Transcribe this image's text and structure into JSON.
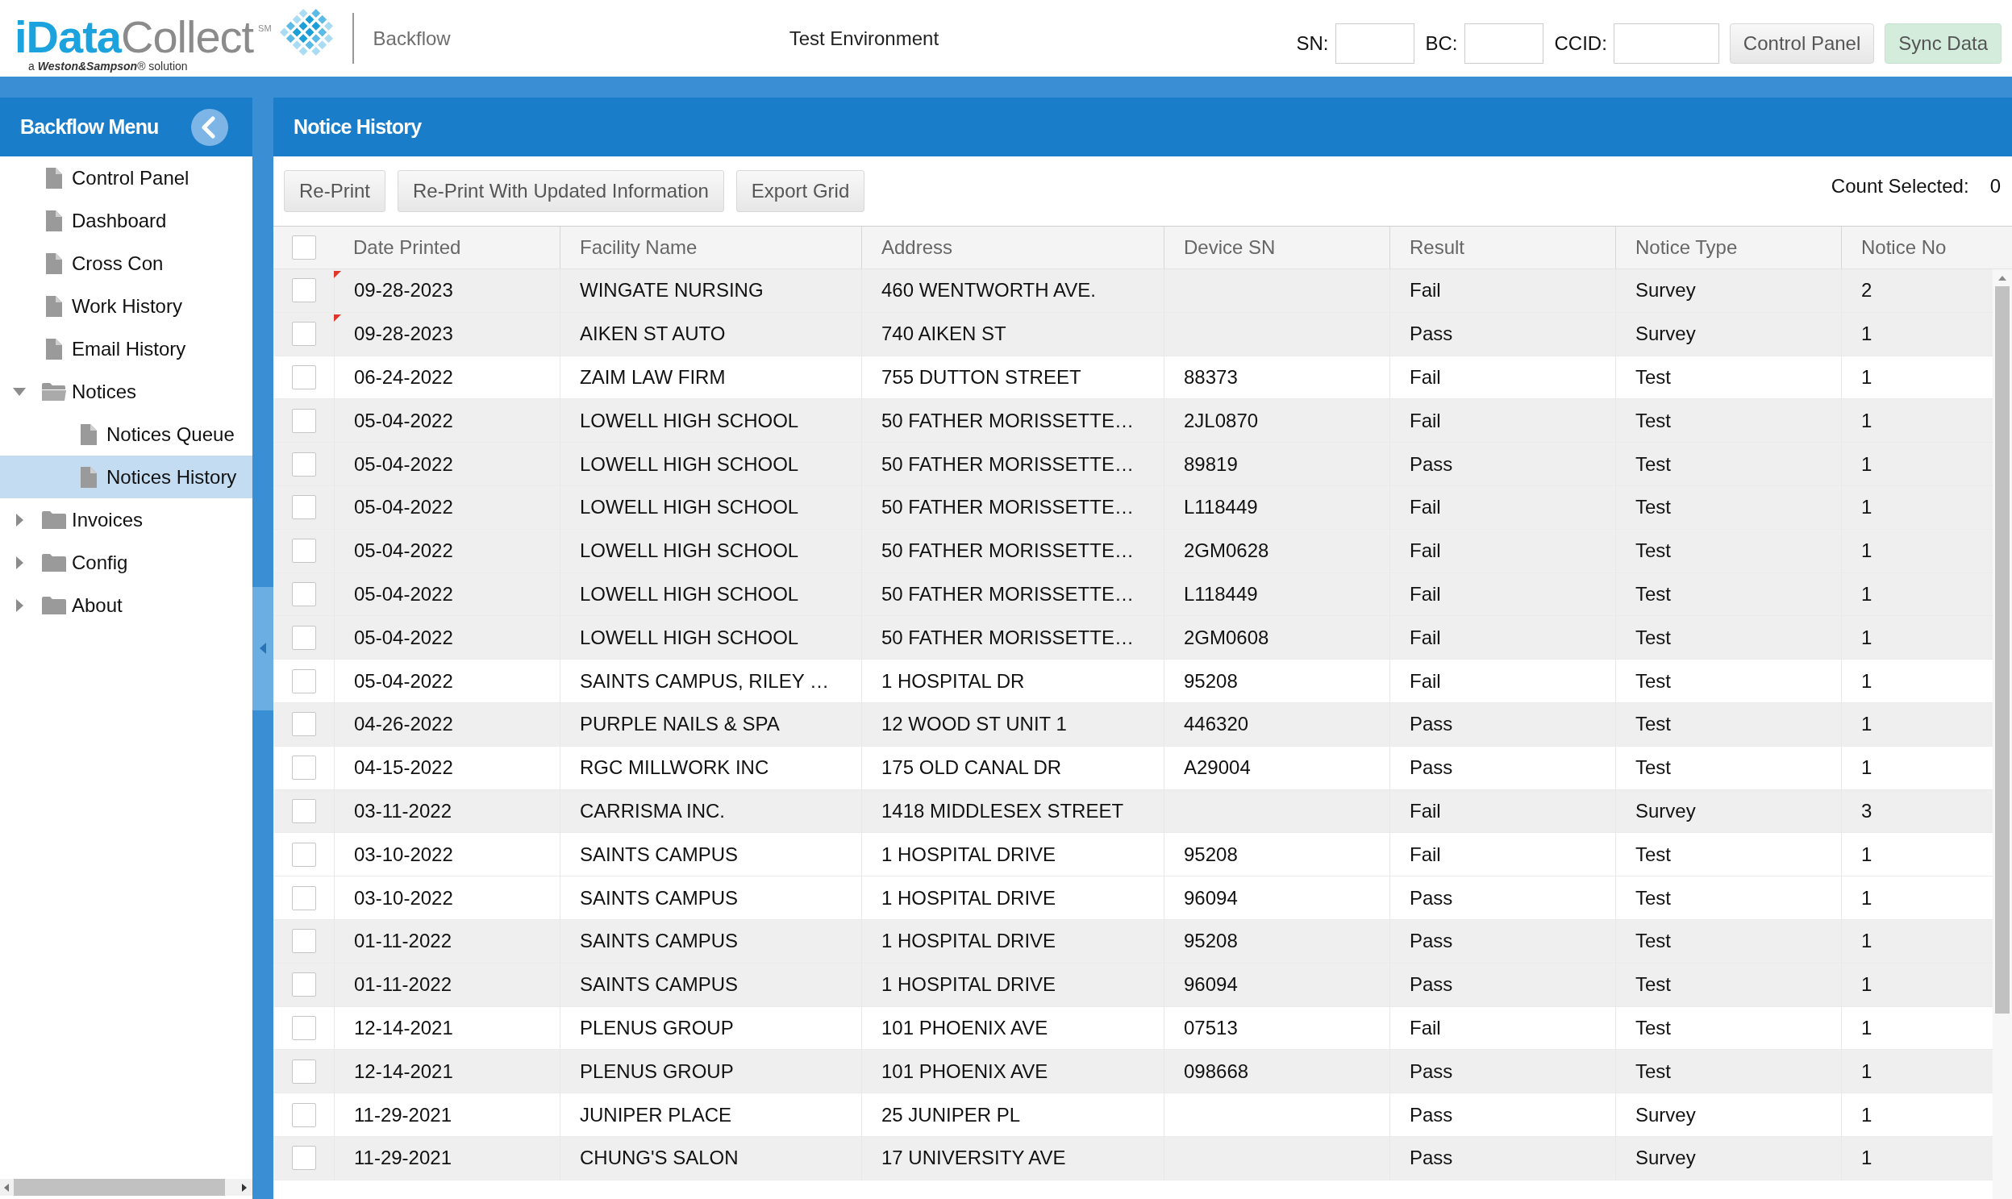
{
  "header": {
    "logo": {
      "wordmark": "**iData**Collect$^{SM}$",
      "tagline": "a **Weston&Sampson**® solution"
    },
    "module": "Backflow",
    "environment": "Test Environment",
    "fields": [
      {
        "label": "SN:"
      },
      {
        "label": "BC:"
      },
      {
        "label": "CCID:"
      }
    ],
    "buttons": [
      {
        "label": "Control Panel",
        "kind": "default"
      },
      {
        "label": "Sync Data",
        "kind": "success"
      }
    ]
  },
  "sidebar": {
    "title": "Backflow Menu",
    "items": [
      {
        "label": "Control Panel",
        "kind": "page",
        "selected": false
      },
      {
        "label": "Dashboard",
        "kind": "page",
        "selected": false
      },
      {
        "label": "Cross Con",
        "kind": "page",
        "selected": false
      },
      {
        "label": "Work History",
        "kind": "page",
        "selected": false
      },
      {
        "label": "Email History",
        "kind": "page",
        "selected": false
      },
      {
        "label": "Notices",
        "kind": "folder",
        "expanded": true,
        "selected": false,
        "children": [
          {
            "label": "Notices Queue",
            "kind": "page",
            "selected": false
          },
          {
            "label": "Notices History",
            "kind": "page",
            "selected": true
          }
        ]
      },
      {
        "label": "Invoices",
        "kind": "folder",
        "expanded": false,
        "selected": false
      },
      {
        "label": "Config",
        "kind": "folder",
        "expanded": false,
        "selected": false
      },
      {
        "label": "About",
        "kind": "folder",
        "expanded": false,
        "selected": false
      }
    ]
  },
  "panel": {
    "title": "Notice History",
    "toolbar": {
      "buttons": [
        "Re-Print",
        "Re-Print With Updated Information",
        "Export Grid"
      ],
      "count_label": "Count Selected:",
      "count": "0"
    },
    "grid": {
      "select_all": {
        "checked": false
      },
      "columns": [
        "Date Printed",
        "Facility Name",
        "Address",
        "Device SN",
        "Result",
        "Notice Type",
        "Notice No"
      ],
      "rows": [
        {
          "checked": false,
          "flagged": true,
          "highlighted": true,
          "date_printed": "09-28-2023",
          "facility_name": "WINGATE NURSING",
          "address": "460 WENTWORTH AVE.",
          "result": "Fail",
          "notice_type": "Survey",
          "notice_no": "2"
        },
        {
          "checked": false,
          "flagged": true,
          "highlighted": true,
          "date_printed": "09-28-2023",
          "facility_name": "AIKEN ST AUTO",
          "address": "740 AIKEN ST",
          "result": "Pass",
          "notice_type": "Survey",
          "notice_no": "1"
        },
        {
          "checked": false,
          "flagged": false,
          "highlighted": false,
          "date_printed": "06-24-2022",
          "facility_name": "ZAIM LAW FIRM",
          "address": "755 DUTTON STREET",
          "device_sn": "88373",
          "result": "Fail",
          "notice_type": "Test",
          "notice_no": "1"
        },
        {
          "checked": false,
          "flagged": false,
          "highlighted": true,
          "date_printed": "05-04-2022",
          "facility_name": "LOWELL HIGH SCHOOL",
          "address": "50 FATHER MORISSETTE…",
          "device_sn": "2JL0870",
          "result": "Fail",
          "notice_type": "Test",
          "notice_no": "1"
        },
        {
          "checked": false,
          "flagged": false,
          "highlighted": true,
          "date_printed": "05-04-2022",
          "facility_name": "LOWELL HIGH SCHOOL",
          "address": "50 FATHER MORISSETTE…",
          "device_sn": "89819",
          "result": "Pass",
          "notice_type": "Test",
          "notice_no": "1"
        },
        {
          "checked": false,
          "flagged": false,
          "highlighted": true,
          "date_printed": "05-04-2022",
          "facility_name": "LOWELL HIGH SCHOOL",
          "address": "50 FATHER MORISSETTE…",
          "device_sn": "L118449",
          "result": "Fail",
          "notice_type": "Test",
          "notice_no": "1"
        },
        {
          "checked": false,
          "flagged": false,
          "highlighted": true,
          "date_printed": "05-04-2022",
          "facility_name": "LOWELL HIGH SCHOOL",
          "address": "50 FATHER MORISSETTE…",
          "device_sn": "2GM0628",
          "result": "Fail",
          "notice_type": "Test",
          "notice_no": "1"
        },
        {
          "checked": false,
          "flagged": false,
          "highlighted": true,
          "date_printed": "05-04-2022",
          "facility_name": "LOWELL HIGH SCHOOL",
          "address": "50 FATHER MORISSETTE…",
          "device_sn": "L118449",
          "result": "Fail",
          "notice_type": "Test",
          "notice_no": "1"
        },
        {
          "checked": false,
          "flagged": false,
          "highlighted": true,
          "date_printed": "05-04-2022",
          "facility_name": "LOWELL HIGH SCHOOL",
          "address": "50 FATHER MORISSETTE…",
          "device_sn": "2GM0608",
          "result": "Fail",
          "notice_type": "Test",
          "notice_no": "1"
        },
        {
          "checked": false,
          "flagged": false,
          "highlighted": false,
          "date_printed": "05-04-2022",
          "facility_name": "SAINTS CAMPUS, RILEY …",
          "address": "1 HOSPITAL DR",
          "device_sn": "95208",
          "result": "Fail",
          "notice_type": "Test",
          "notice_no": "1"
        },
        {
          "checked": false,
          "flagged": false,
          "highlighted": true,
          "date_printed": "04-26-2022",
          "facility_name": "PURPLE NAILS & SPA",
          "address": "12 WOOD ST UNIT 1",
          "device_sn": "446320",
          "result": "Pass",
          "notice_type": "Test",
          "notice_no": "1"
        },
        {
          "checked": false,
          "flagged": false,
          "highlighted": false,
          "date_printed": "04-15-2022",
          "facility_name": "RGC MILLWORK INC",
          "address": "175 OLD CANAL DR",
          "device_sn": "A29004",
          "result": "Pass",
          "notice_type": "Test",
          "notice_no": "1"
        },
        {
          "checked": false,
          "flagged": false,
          "highlighted": true,
          "date_printed": "03-11-2022",
          "facility_name": "CARRISMA INC.",
          "address": "1418 MIDDLESEX STREET",
          "result": "Fail",
          "notice_type": "Survey",
          "notice_no": "3"
        },
        {
          "checked": false,
          "flagged": false,
          "highlighted": false,
          "date_printed": "03-10-2022",
          "facility_name": "SAINTS CAMPUS",
          "address": "1 HOSPITAL DRIVE",
          "device_sn": "95208",
          "result": "Fail",
          "notice_type": "Test",
          "notice_no": "1"
        },
        {
          "checked": false,
          "flagged": false,
          "highlighted": false,
          "date_printed": "03-10-2022",
          "facility_name": "SAINTS CAMPUS",
          "address": "1 HOSPITAL DRIVE",
          "device_sn": "96094",
          "result": "Pass",
          "notice_type": "Test",
          "notice_no": "1"
        },
        {
          "checked": false,
          "flagged": false,
          "highlighted": true,
          "date_printed": "01-11-2022",
          "facility_name": "SAINTS CAMPUS",
          "address": "1 HOSPITAL DRIVE",
          "device_sn": "95208",
          "result": "Pass",
          "notice_type": "Test",
          "notice_no": "1"
        },
        {
          "checked": false,
          "flagged": false,
          "highlighted": true,
          "date_printed": "01-11-2022",
          "facility_name": "SAINTS CAMPUS",
          "address": "1 HOSPITAL DRIVE",
          "device_sn": "96094",
          "result": "Pass",
          "notice_type": "Test",
          "notice_no": "1"
        },
        {
          "checked": false,
          "flagged": false,
          "highlighted": false,
          "date_printed": "12-14-2021",
          "facility_name": "PLENUS GROUP",
          "address": "101 PHOENIX AVE",
          "device_sn": "07513",
          "result": "Fail",
          "notice_type": "Test",
          "notice_no": "1"
        },
        {
          "checked": false,
          "flagged": false,
          "highlighted": true,
          "date_printed": "12-14-2021",
          "facility_name": "PLENUS GROUP",
          "address": "101 PHOENIX AVE",
          "device_sn": "098668",
          "result": "Pass",
          "notice_type": "Test",
          "notice_no": "1"
        },
        {
          "checked": false,
          "flagged": false,
          "highlighted": false,
          "date_printed": "11-29-2021",
          "facility_name": "JUNIPER PLACE",
          "address": "25 JUNIPER PL",
          "result": "Pass",
          "notice_type": "Survey",
          "notice_no": "1"
        },
        {
          "checked": false,
          "flagged": false,
          "highlighted": true,
          "date_printed": "11-29-2021",
          "facility_name": "CHUNG'S SALON",
          "address": "17 UNIVERSITY AVE",
          "result": "Pass",
          "notice_type": "Survey",
          "notice_no": "1"
        }
      ]
    }
  }
}
